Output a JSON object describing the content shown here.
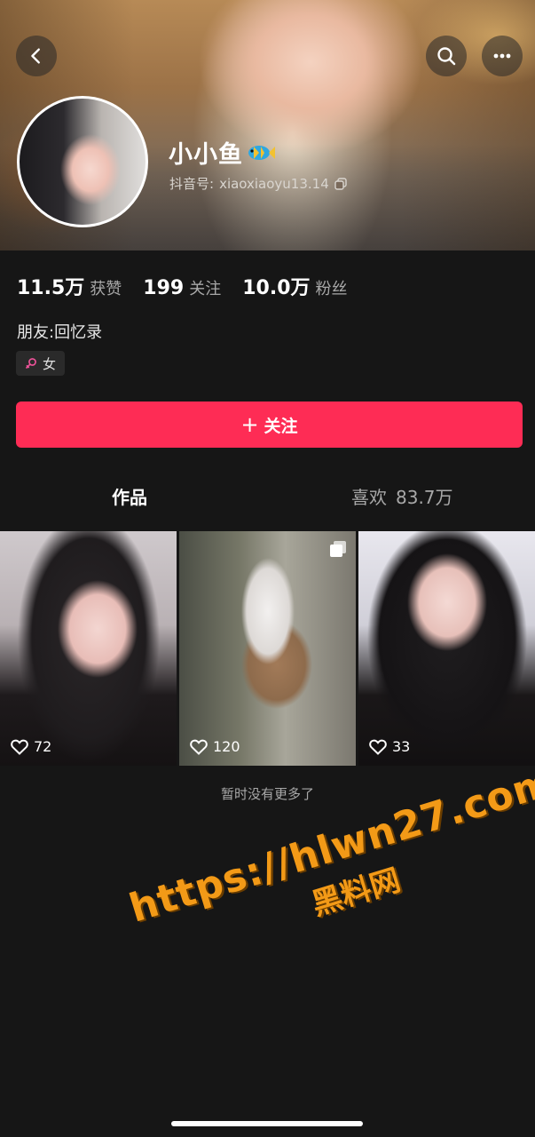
{
  "header": {
    "nickname": "小小鱼",
    "account_label": "抖音号:",
    "account_id": "xiaoxiaoyu13.14"
  },
  "stats": [
    {
      "value": "11.5万",
      "label": "获赞"
    },
    {
      "value": "199",
      "label": "关注"
    },
    {
      "value": "10.0万",
      "label": "粉丝"
    }
  ],
  "profile": {
    "friends_text": "朋友:回忆录",
    "gender": "女"
  },
  "follow_button": {
    "plus": "+",
    "label": "关注"
  },
  "tabs": {
    "works": "作品",
    "likes_label": "喜欢",
    "likes_count": "83.7万"
  },
  "videos": [
    {
      "likes": "72"
    },
    {
      "likes": "120"
    },
    {
      "likes": "33"
    }
  ],
  "footer": {
    "no_more": "暂时没有更多了"
  },
  "watermark": {
    "url": "https://hlwn27.com",
    "text": "黑料网"
  },
  "colors": {
    "accent": "#fe2c55",
    "background": "#161616",
    "watermark": "#f39a17"
  }
}
